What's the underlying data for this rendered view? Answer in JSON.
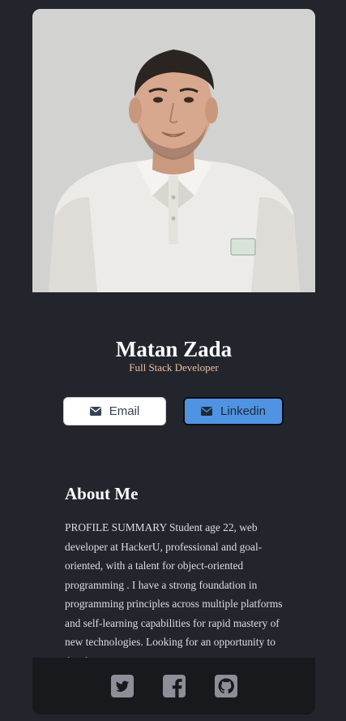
{
  "profile": {
    "name": "Matan Zada",
    "title": "Full Stack Developer"
  },
  "buttons": {
    "email_label": "Email",
    "linkedin_label": "Linkedin"
  },
  "about": {
    "heading": "About Me",
    "text": "PROFILE SUMMARY Student age 22, web developer at HackerU, professional and goal-oriented, with a talent for object-oriented programming . I have a strong foundation in programming principles across multiple platforms and self-learning capabilities for rapid mastery of new technologies. Looking for an opportunity to develop as a"
  },
  "footer": {
    "social_icons": [
      "twitter-icon",
      "facebook-icon",
      "github-icon"
    ]
  },
  "colors": {
    "page_background": "#23252d",
    "footer_background": "#18191d",
    "accent_subtitle": "#f3bf99",
    "linkedin_button": "#5093e2",
    "social_icon": "#8e8e98"
  }
}
